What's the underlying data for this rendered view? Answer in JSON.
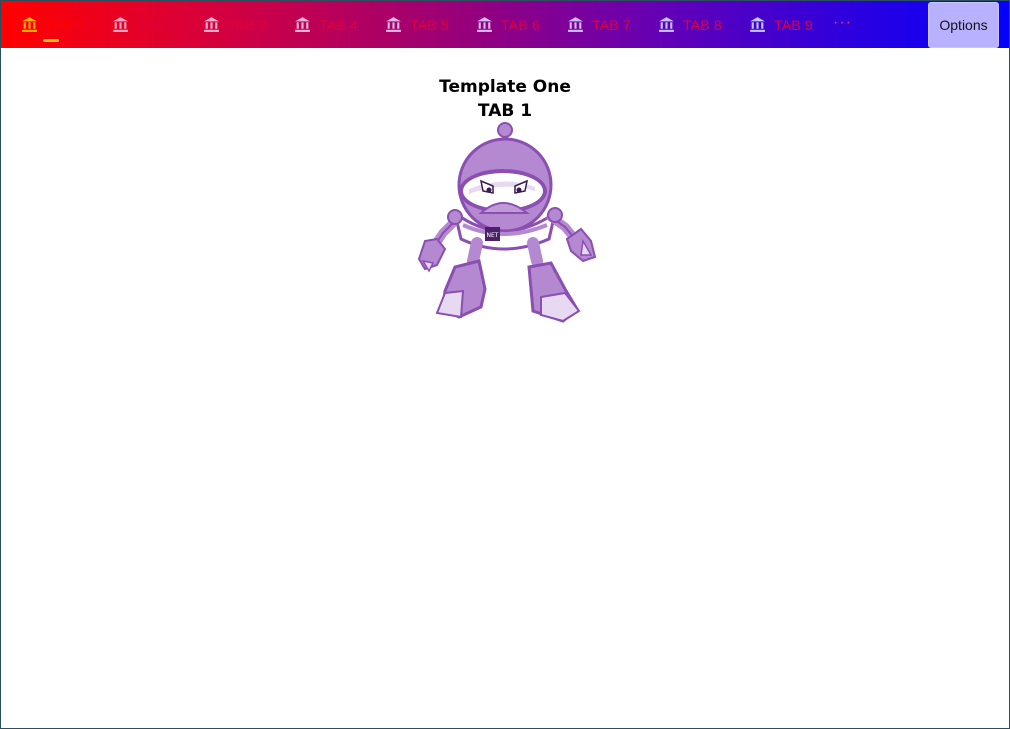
{
  "tabs": [
    {
      "label": "TAB 1",
      "icon": "bank-icon",
      "selected": true
    },
    {
      "label": "TAB 3",
      "icon": "bank-icon"
    },
    {
      "label": "TAB 3",
      "icon": "bank-icon"
    },
    {
      "label": "TAB 4",
      "icon": "bank-icon"
    },
    {
      "label": "TAB 5",
      "icon": "bank-icon"
    },
    {
      "label": "TAB 6",
      "icon": "bank-icon"
    },
    {
      "label": "TAB 7",
      "icon": "bank-icon"
    },
    {
      "label": "TAB 8",
      "icon": "bank-icon"
    },
    {
      "label": "TAB 9",
      "icon": "bank-icon"
    }
  ],
  "more_label": "···",
  "options_label": "Options",
  "content": {
    "title": "Template One",
    "subtitle": "TAB 1",
    "badge_text": "NET"
  },
  "colors": {
    "tabbar_start": "#ff0000",
    "tabbar_end": "#0400ff",
    "tab_text": "#e0003a",
    "selected_indicator": "#f5c400",
    "options_bg": "#b7b1ff",
    "robot_purple": "#a776c5"
  }
}
